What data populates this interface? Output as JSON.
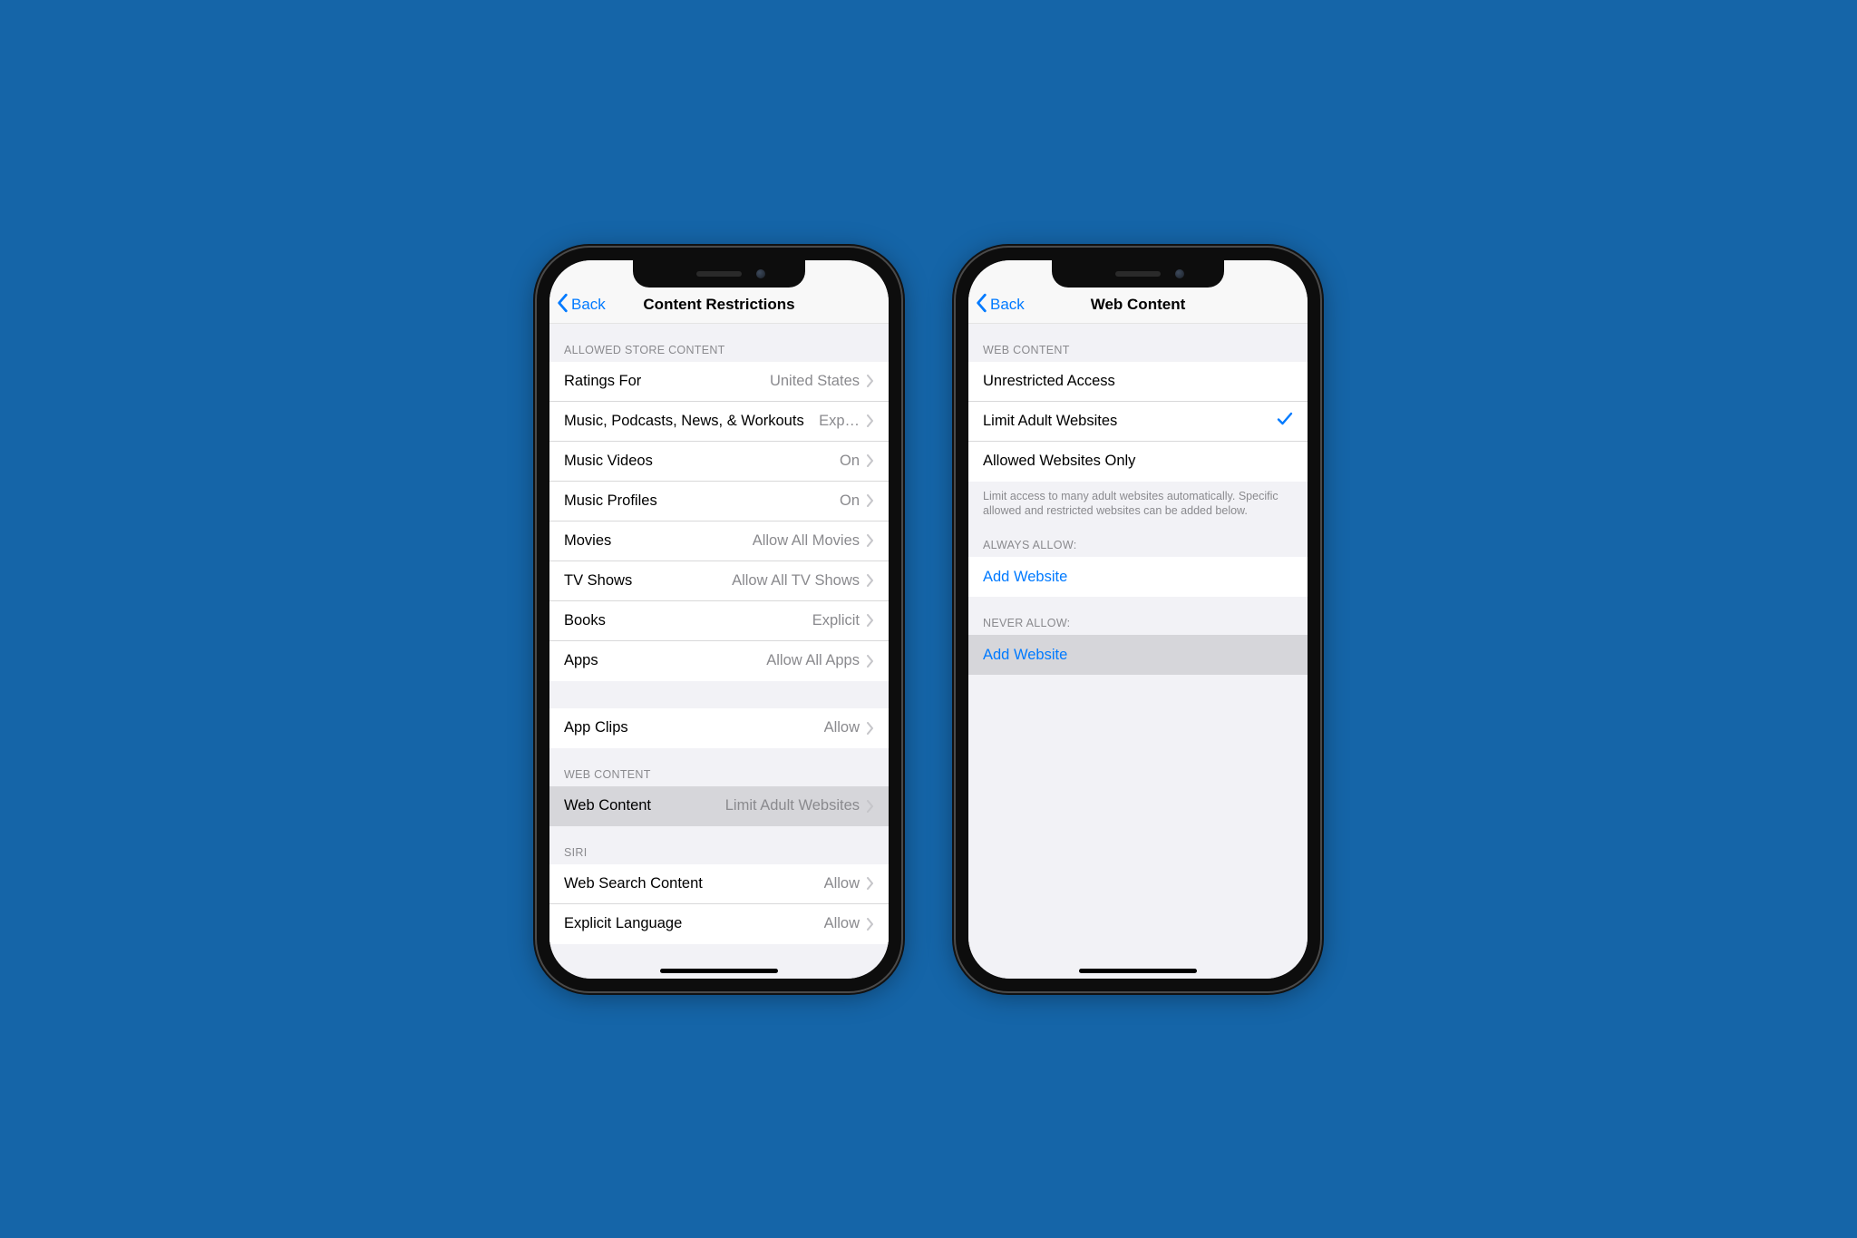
{
  "left": {
    "nav": {
      "back": "Back",
      "title": "Content Restrictions"
    },
    "sections": {
      "store": {
        "header": "ALLOWED STORE CONTENT",
        "rows": [
          {
            "label": "Ratings For",
            "value": "United States"
          },
          {
            "label": "Music, Podcasts, News, & Workouts",
            "value": "Exp…"
          },
          {
            "label": "Music Videos",
            "value": "On"
          },
          {
            "label": "Music Profiles",
            "value": "On"
          },
          {
            "label": "Movies",
            "value": "Allow All Movies"
          },
          {
            "label": "TV Shows",
            "value": "Allow All TV Shows"
          },
          {
            "label": "Books",
            "value": "Explicit"
          },
          {
            "label": "Apps",
            "value": "Allow All Apps"
          }
        ]
      },
      "appclips": {
        "rows": [
          {
            "label": "App Clips",
            "value": "Allow"
          }
        ]
      },
      "web": {
        "header": "WEB CONTENT",
        "rows": [
          {
            "label": "Web Content",
            "value": "Limit Adult Websites"
          }
        ]
      },
      "siri": {
        "header": "SIRI",
        "rows": [
          {
            "label": "Web Search Content",
            "value": "Allow"
          },
          {
            "label": "Explicit Language",
            "value": "Allow"
          }
        ]
      }
    }
  },
  "right": {
    "nav": {
      "back": "Back",
      "title": "Web Content"
    },
    "sections": {
      "options": {
        "header": "WEB CONTENT",
        "rows": [
          {
            "label": "Unrestricted Access",
            "selected": false
          },
          {
            "label": "Limit Adult Websites",
            "selected": true
          },
          {
            "label": "Allowed Websites Only",
            "selected": false
          }
        ],
        "footer": "Limit access to many adult websites automatically. Specific allowed and restricted websites can be added below."
      },
      "always": {
        "header": "ALWAYS ALLOW:",
        "add": "Add Website"
      },
      "never": {
        "header": "NEVER ALLOW:",
        "add": "Add Website"
      }
    }
  }
}
